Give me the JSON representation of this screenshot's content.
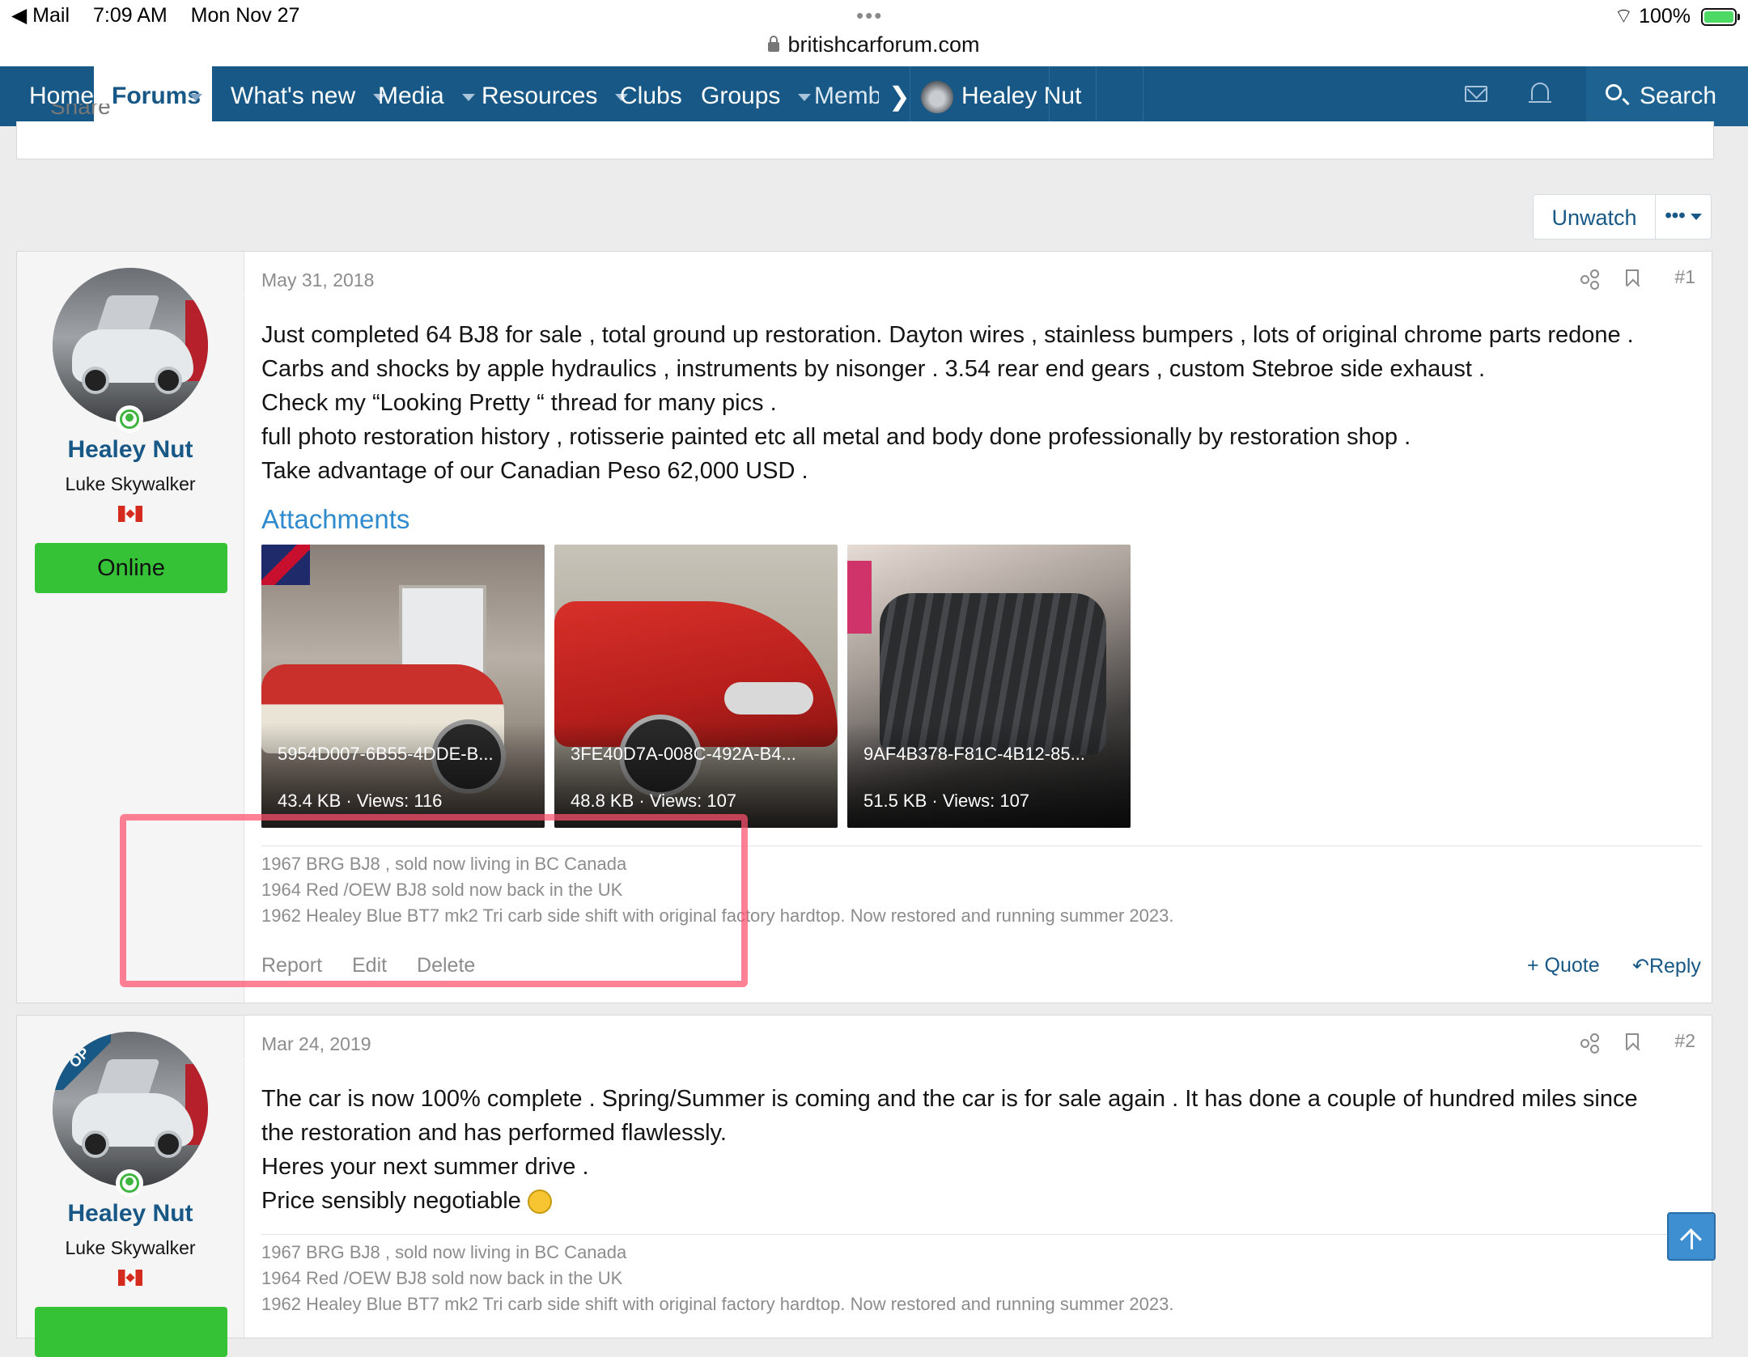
{
  "status_bar": {
    "back_app": "◀ Mail",
    "time": "7:09 AM",
    "date": "Mon Nov 27",
    "dots": "•••",
    "url": "britishcarforum.com",
    "battery": "100%"
  },
  "nav": {
    "home": "Home",
    "forums": "Forums",
    "whats_new": "What's new",
    "media": "Media",
    "resources": "Resources",
    "clubs": "Clubs",
    "groups": "Groups",
    "members": "Membe",
    "more_arrow": "❯",
    "user": "Healey Nut",
    "search": "Search"
  },
  "share_remnant": "Share",
  "thread_controls": {
    "unwatch": "Unwatch",
    "more": "•••"
  },
  "posts": [
    {
      "user": {
        "name": "Healey Nut",
        "title": "Luke Skywalker",
        "status": "Online"
      },
      "date": "May 31, 2018",
      "number": "#1",
      "body": [
        "Just completed 64 BJ8 for sale , total ground up restoration. Dayton wires , stainless bumpers , lots of original chrome parts redone .",
        "Carbs and shocks by apple hydraulics , instruments by nisonger . 3.54 rear end gears , custom Stebroe side exhaust .",
        "Check my “Looking Pretty “ thread for many pics .",
        "full photo restoration history , rotisserie painted etc all metal and body done professionally by restoration shop .",
        "Take advantage of our Canadian Peso 62,000 USD ."
      ],
      "attachments_title": "Attachments",
      "attachments": [
        {
          "name": "5954D007-6B55-4DDE-B...",
          "info": "43.4 KB · Views: 116"
        },
        {
          "name": "3FE40D7A-008C-492A-B4...",
          "info": "48.8 KB · Views: 107"
        },
        {
          "name": "9AF4B378-F81C-4B12-85...",
          "info": "51.5 KB · Views: 107"
        }
      ],
      "signature": [
        "1967 BRG BJ8 , sold now living in BC Canada",
        "1964 Red /OEW BJ8 sold now back in the UK",
        "1962 Healey Blue BT7 mk2 Tri carb side shift with original factory hardtop. Now restored and running summer 2023."
      ],
      "actions": {
        "report": "Report",
        "edit": "Edit",
        "delete": "Delete",
        "quote": "+ Quote",
        "reply": "Reply"
      }
    },
    {
      "user": {
        "name": "Healey Nut",
        "title": "Luke Skywalker",
        "badge": "OP"
      },
      "date": "Mar 24, 2019",
      "number": "#2",
      "body": [
        "The car is now 100% complete . Spring/Summer is coming and the car is for sale again . It has done a couple of hundred miles since",
        "the restoration and has performed flawlessly.",
        "Heres your next summer drive .",
        "Price sensibly negotiable"
      ],
      "signature": [
        "1967 BRG BJ8 , sold now living in BC Canada",
        "1964 Red /OEW BJ8 sold now back in the UK",
        "1962 Healey Blue BT7 mk2 Tri carb side shift with original factory hardtop. Now restored and running summer 2023."
      ]
    }
  ],
  "colors": {
    "nav_bg": "#185886",
    "link": "#185886",
    "online_green": "#36c236",
    "highlight": "#ff506e"
  }
}
